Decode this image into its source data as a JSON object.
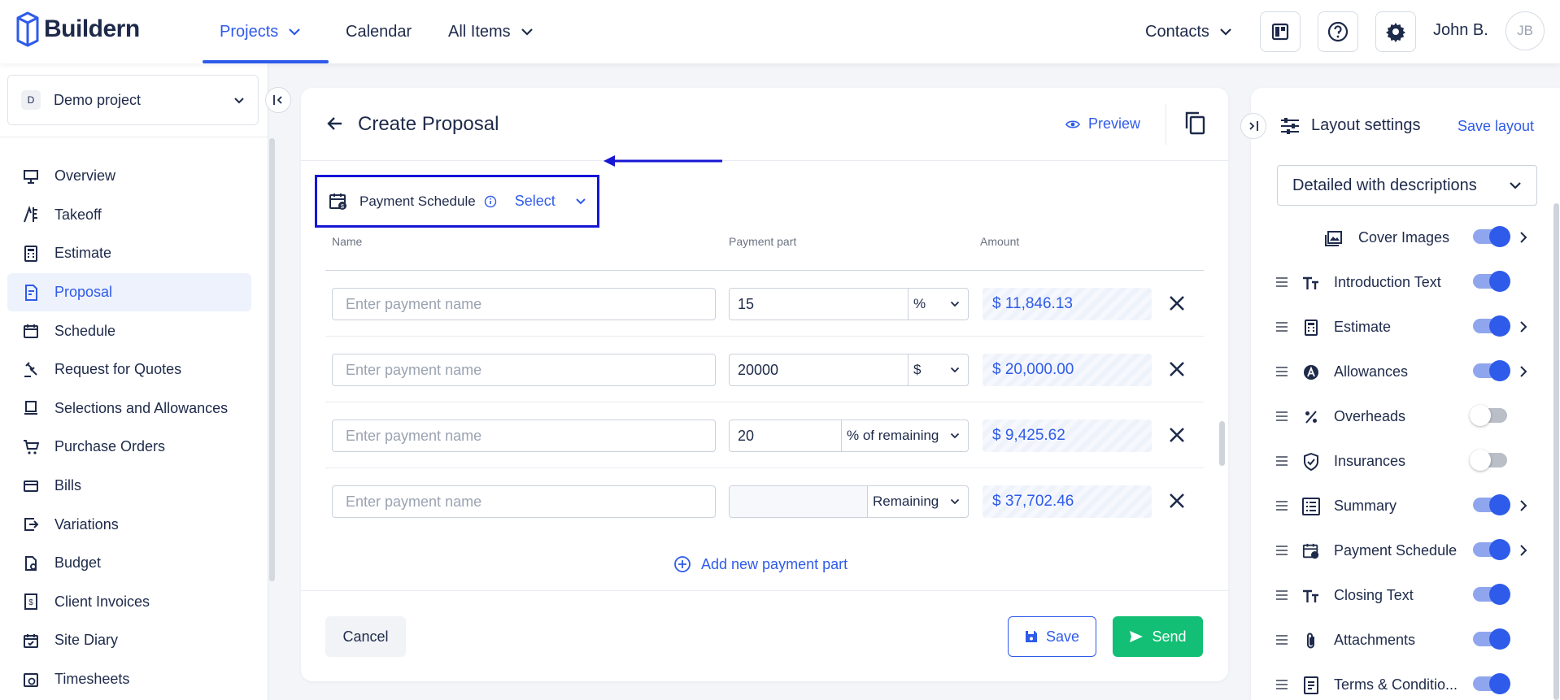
{
  "app": {
    "brand": "Buildern"
  },
  "topnav": {
    "items": [
      {
        "label": "Projects",
        "active": true,
        "dropdown": true
      },
      {
        "label": "Calendar",
        "active": false,
        "dropdown": false
      },
      {
        "label": "All Items",
        "active": false,
        "dropdown": true
      }
    ],
    "contacts": "Contacts",
    "user_name": "John B.",
    "user_initials": "JB",
    "icons": [
      "dashboard-icon",
      "help-icon",
      "gear-icon"
    ]
  },
  "sidebar": {
    "project": {
      "badge": "D",
      "name": "Demo project"
    },
    "items": [
      {
        "label": "Overview",
        "icon": "overview-icon"
      },
      {
        "label": "Takeoff",
        "icon": "takeoff-icon"
      },
      {
        "label": "Estimate",
        "icon": "calculator-icon"
      },
      {
        "label": "Proposal",
        "icon": "proposal-icon",
        "active": true
      },
      {
        "label": "Schedule",
        "icon": "calendar-icon"
      },
      {
        "label": "Request for Quotes",
        "icon": "gavel-icon"
      },
      {
        "label": "Selections and Allowances",
        "icon": "selections-icon"
      },
      {
        "label": "Purchase Orders",
        "icon": "cart-icon"
      },
      {
        "label": "Bills",
        "icon": "bills-icon"
      },
      {
        "label": "Variations",
        "icon": "variations-icon"
      },
      {
        "label": "Budget",
        "icon": "budget-icon"
      },
      {
        "label": "Client Invoices",
        "icon": "invoice-icon"
      },
      {
        "label": "Site Diary",
        "icon": "diary-icon"
      },
      {
        "label": "Timesheets",
        "icon": "timesheet-icon"
      }
    ]
  },
  "main": {
    "title": "Create Proposal",
    "preview": "Preview",
    "payment_schedule": {
      "label": "Payment Schedule",
      "select": "Select"
    },
    "columns": {
      "name": "Name",
      "part": "Payment part",
      "amount": "Amount"
    },
    "rows": [
      {
        "placeholder": "Enter payment name",
        "value": "15",
        "unit": "%",
        "amount": "$ 11,846.13"
      },
      {
        "placeholder": "Enter payment name",
        "value": "20000",
        "unit": "$",
        "amount": "$ 20,000.00"
      },
      {
        "placeholder": "Enter payment name",
        "value": "20",
        "unit": "% of remaining",
        "amount": "$ 9,425.62"
      },
      {
        "placeholder": "Enter payment name",
        "value": "",
        "unit": "Remaining",
        "amount": "$ 37,702.46"
      }
    ],
    "add_part": "Add new payment part",
    "cancel": "Cancel",
    "save": "Save",
    "send": "Send"
  },
  "layout_settings": {
    "title": "Layout settings",
    "save": "Save layout",
    "mode": "Detailed with descriptions",
    "items": [
      {
        "label": "Cover Images",
        "on": true,
        "chevron": true,
        "drag": false,
        "sub": true
      },
      {
        "label": "Introduction Text",
        "on": true,
        "chevron": false,
        "drag": true
      },
      {
        "label": "Estimate",
        "on": true,
        "chevron": true,
        "drag": true
      },
      {
        "label": "Allowances",
        "on": true,
        "chevron": true,
        "drag": true
      },
      {
        "label": "Overheads",
        "on": false,
        "chevron": false,
        "drag": true
      },
      {
        "label": "Insurances",
        "on": false,
        "chevron": false,
        "drag": true
      },
      {
        "label": "Summary",
        "on": true,
        "chevron": true,
        "drag": true
      },
      {
        "label": "Payment Schedule",
        "on": true,
        "chevron": true,
        "drag": true
      },
      {
        "label": "Closing Text",
        "on": true,
        "chevron": false,
        "drag": true
      },
      {
        "label": "Attachments",
        "on": true,
        "chevron": false,
        "drag": true
      },
      {
        "label": "Terms & Conditio...",
        "on": true,
        "chevron": false,
        "drag": true
      }
    ]
  },
  "colors": {
    "accent": "#2f5bea",
    "send": "#12bf74",
    "annotation": "#1616d6"
  }
}
